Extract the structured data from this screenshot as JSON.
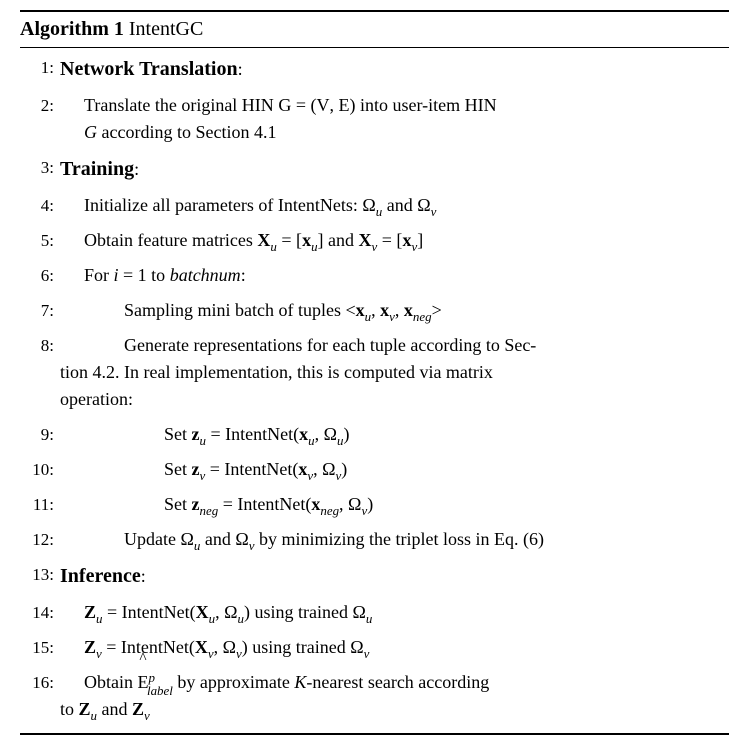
{
  "header": {
    "algo_label": "Algorithm 1",
    "algo_name": " IntentGC"
  },
  "phases": {
    "network": "Network Translation",
    "training": "Training",
    "inference": "Inference"
  },
  "ln": {
    "1": "1:",
    "2": "2:",
    "3": "3:",
    "4": "4:",
    "5": "5:",
    "6": "6:",
    "7": "7:",
    "8": "8:",
    "9": "9:",
    "10": "10:",
    "11": "11:",
    "12": "12:",
    "13": "13:",
    "14": "14:",
    "15": "15:",
    "16": "16:"
  },
  "txt": {
    "l2_a": "Translate the original HIN ",
    "G_cal": "G",
    "eq": " = (",
    "V_cal": "V",
    "comma": ", ",
    "E_cal": "E",
    "rp_into": ") into user-item HIN",
    "l2_b": " according to Section 4.1",
    "G_it": "G",
    "colon": ":",
    "l4_a": "Initialize all parameters of IntentNets: Ω",
    "u": "u",
    "and": " and Ω",
    "v": "v",
    "l5_a": "Obtain feature matrices ",
    "X": "X",
    "eqb": " = [",
    "xb": "x",
    "rb_and": "] and ",
    "rb": "]",
    "l6_a": "For ",
    "i": "i",
    "eq1": " = 1 to ",
    "batchnum": "batchnum",
    "l7": "Sampling mini batch of tuples <",
    "gt": ">",
    "l8_a": "Generate representations for each tuple according to Sec-",
    "l8_b": "tion 4.2. In real implementation, this is computed via matrix",
    "l8_c": "operation:",
    "set": "Set ",
    "z": "z",
    "intentnet_x": " = IntentNet(",
    "com_om": ", Ω",
    "rp": ")",
    "neg": "neg",
    "l12_a": "Update Ω",
    "l12_b": " by minimizing the triplet loss in Eq. (6)",
    "Z": "Z",
    "using": ") using trained Ω",
    "l16_a": "Obtain ",
    "label": "label",
    "p": "p",
    "l16_b": " by approximate ",
    "K": "K",
    "l16_c": "-nearest search according",
    "l16_d": "to ",
    "and2": " and "
  }
}
